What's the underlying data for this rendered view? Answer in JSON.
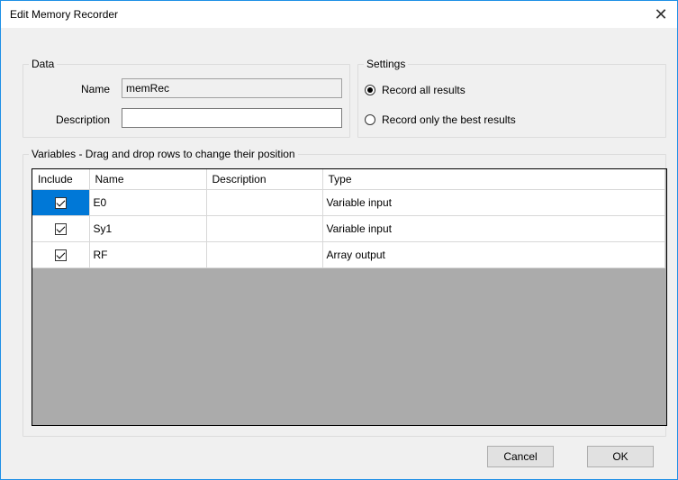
{
  "window": {
    "title": "Edit Memory Recorder",
    "close_glyph": "✕"
  },
  "data_group": {
    "legend": "Data",
    "name_label": "Name",
    "name_value": "memRec",
    "description_label": "Description",
    "description_value": ""
  },
  "settings_group": {
    "legend": "Settings",
    "options": [
      {
        "label": "Record all results",
        "checked": true
      },
      {
        "label": "Record only the best results",
        "checked": false
      }
    ]
  },
  "variables_group": {
    "legend": "Variables - Drag and drop rows to change their position",
    "columns": [
      "Include",
      "Name",
      "Description",
      "Type"
    ],
    "rows": [
      {
        "include": true,
        "name": "E0",
        "description": "",
        "type": "Variable input",
        "selected": true
      },
      {
        "include": true,
        "name": "Sy1",
        "description": "",
        "type": "Variable input",
        "selected": false
      },
      {
        "include": true,
        "name": "RF",
        "description": "",
        "type": "Array output",
        "selected": false
      }
    ]
  },
  "buttons": {
    "cancel": "Cancel",
    "ok": "OK"
  },
  "colors": {
    "accent": "#0078d7",
    "grid_empty": "#ababab",
    "window_border": "#1e90e6"
  }
}
